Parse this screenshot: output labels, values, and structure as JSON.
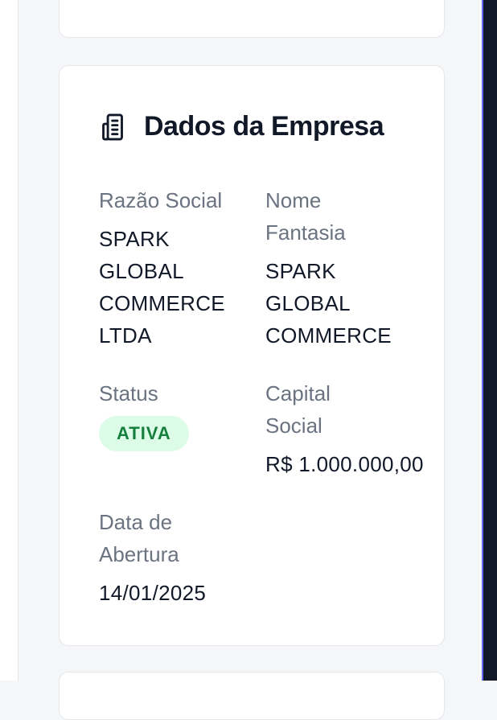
{
  "card": {
    "title": "Dados da Empresa",
    "icon": "building-icon"
  },
  "fields": {
    "razao_social": {
      "label": "Razão Social",
      "value": "SPARK\nGLOBAL\nCOMMERCE\nLTDA"
    },
    "nome_fantasia": {
      "label": "Nome\nFantasia",
      "value": "SPARK\nGLOBAL\nCOMMERCE"
    },
    "status": {
      "label": "Status",
      "value": "ATIVA"
    },
    "capital_social": {
      "label": "Capital\nSocial",
      "value": "R$ 1.000.000,00"
    },
    "data_abertura": {
      "label": "Data de\nAbertura",
      "value": "14/01/2025"
    }
  },
  "colors": {
    "badge_bg": "#dcfce7",
    "badge_text": "#15803d",
    "accent_right": "#6366f1"
  }
}
